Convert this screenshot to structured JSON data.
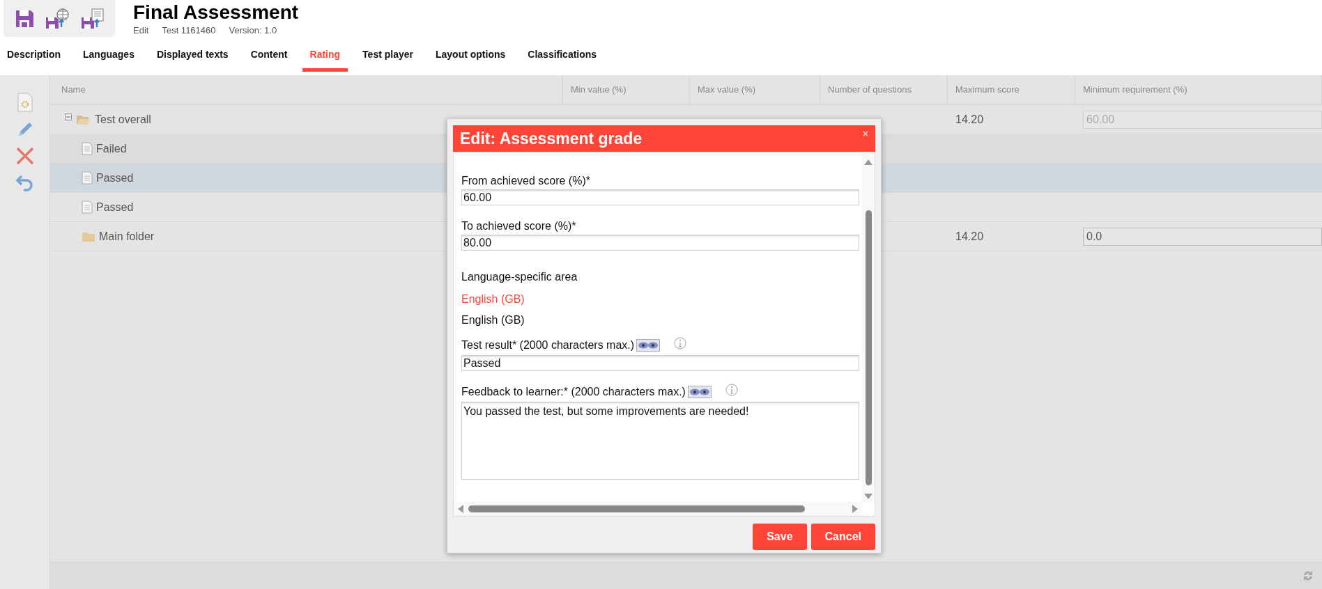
{
  "header": {
    "title": "Final Assessment",
    "meta": [
      "Edit",
      "Test 1161460",
      "Version: 1.0"
    ]
  },
  "tabs": [
    {
      "label": "Description",
      "selected": false
    },
    {
      "label": "Languages",
      "selected": false
    },
    {
      "label": "Displayed texts",
      "selected": false
    },
    {
      "label": "Content",
      "selected": false
    },
    {
      "label": "Rating",
      "selected": true
    },
    {
      "label": "Test player",
      "selected": false
    },
    {
      "label": "Layout options",
      "selected": false
    },
    {
      "label": "Classifications",
      "selected": false
    }
  ],
  "table": {
    "columns": [
      "Name",
      "Min value (%)",
      "Max value (%)",
      "Number of questions",
      "Maximum score",
      "Minimum requirement (%)"
    ],
    "rows": [
      {
        "name": "Test overall",
        "kind": "folder",
        "expanded": true,
        "selected": false,
        "maximum_score": "14.20",
        "minimum_requirement": {
          "value": "60.00",
          "disabled": true
        },
        "children": [
          {
            "name": "Failed",
            "kind": "document",
            "selected": false,
            "hovered": true
          },
          {
            "name": "Passed",
            "kind": "document",
            "selected": true
          },
          {
            "name": "Passed",
            "kind": "document",
            "selected": false
          },
          {
            "name": "Main folder",
            "kind": "folder",
            "selected": false,
            "maximum_score": "14.20",
            "minimum_requirement": {
              "value": "0.0",
              "disabled": false
            }
          }
        ]
      }
    ]
  },
  "dialog": {
    "title": "Edit: Assessment grade",
    "close": "×",
    "fields": [
      {
        "label": "From achieved score (%)*",
        "value": "60.00"
      },
      {
        "label": "To achieved score (%)*",
        "value": "80.00"
      }
    ],
    "language_area": {
      "heading": "Language-specific area",
      "languages": [
        {
          "label": "English (GB)",
          "selected": true
        }
      ],
      "current": "English (GB)"
    },
    "text_fields": [
      {
        "label": "Test result* (2000 characters max.)",
        "value": "Passed",
        "kind": "line"
      },
      {
        "label": "Feedback to learner:* (2000 characters max.)",
        "value": "You passed the test, but some improvements are needed!",
        "kind": "area"
      }
    ],
    "buttons": [
      "Save",
      "Cancel"
    ]
  }
}
